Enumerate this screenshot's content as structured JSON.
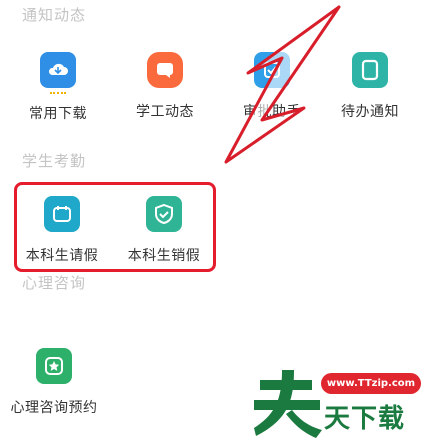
{
  "sections": {
    "notices": {
      "title": "通知动态"
    },
    "attendance": {
      "title": "学生考勤"
    },
    "counseling": {
      "title": "心理咨询"
    }
  },
  "notices_items": [
    {
      "label": "常用下载",
      "icon": "cloud-download-icon",
      "color": "#2f8fe6"
    },
    {
      "label": "学工动态",
      "icon": "message-icon",
      "color": "#fa6a3c"
    },
    {
      "label": "审批助手",
      "icon": "approval-icon",
      "color": "#2e9fe8"
    },
    {
      "label": "待办通知",
      "icon": "document-icon",
      "color": "#2db4a6"
    }
  ],
  "attendance_items": [
    {
      "label": "本科生请假",
      "icon": "leave-request-icon",
      "color": "#1fa8c9"
    },
    {
      "label": "本科生销假",
      "icon": "leave-cancel-icon",
      "color": "#2fb496"
    }
  ],
  "counseling_items": [
    {
      "label": "心理咨询预约",
      "icon": "heart-star-icon",
      "color": "#2db16a"
    }
  ],
  "watermark": {
    "url": "www.TTzip.com",
    "brand": "天下载",
    "brand_color": "#1b7a3f",
    "url_bg": "#e0262f"
  },
  "highlight_color": "#e51c2c"
}
